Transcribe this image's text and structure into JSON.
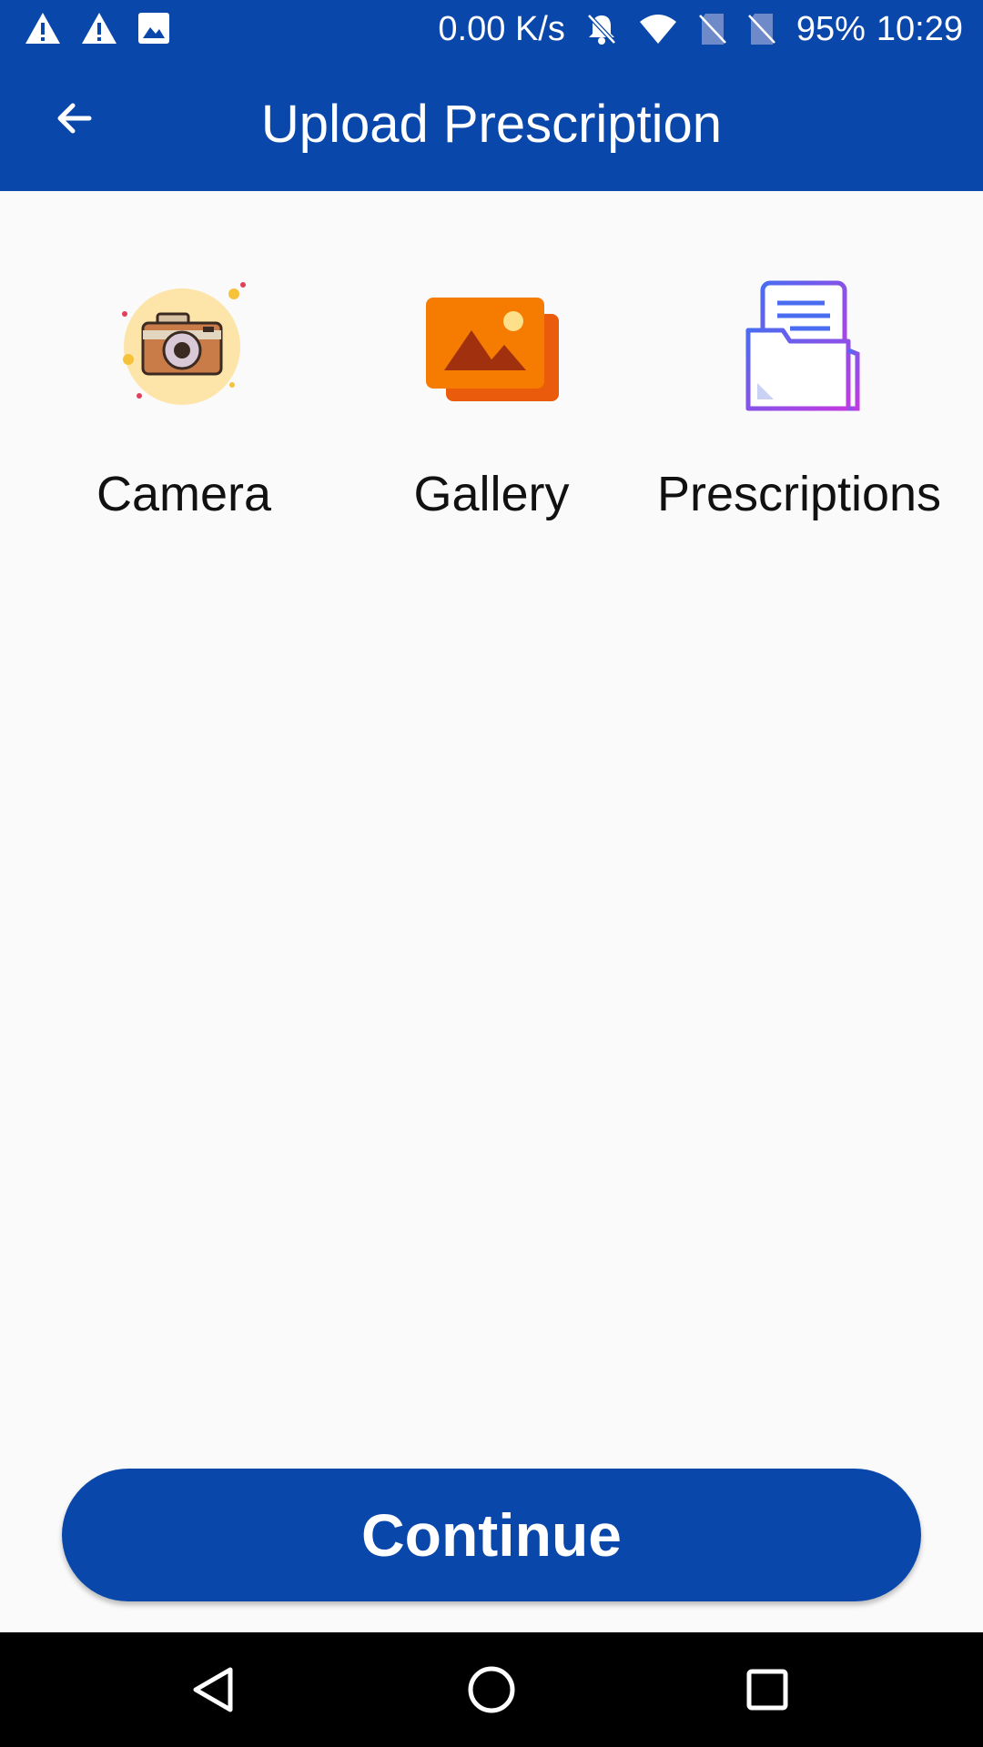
{
  "status_bar": {
    "speed": "0.00 K/s",
    "battery": "95%",
    "time": "10:29",
    "left_icons": [
      "warning-icon",
      "warning-icon",
      "image-icon"
    ],
    "right_icons": [
      "bell-off-icon",
      "wifi-icon",
      "no-sim-icon",
      "no-sim-icon"
    ]
  },
  "app_bar": {
    "title": "Upload Prescription",
    "back_icon": "arrow-left-icon"
  },
  "options": [
    {
      "label": "Camera",
      "icon": "camera-icon"
    },
    {
      "label": "Gallery",
      "icon": "gallery-icon"
    },
    {
      "label": "Prescriptions",
      "icon": "folder-icon"
    }
  ],
  "continue_label": "Continue",
  "nav_bar": {
    "icons": [
      "back-triangle-icon",
      "home-circle-icon",
      "recents-square-icon"
    ]
  },
  "colors": {
    "primary": "#0a47ab",
    "background": "#fafafa",
    "nav": "#000000"
  }
}
